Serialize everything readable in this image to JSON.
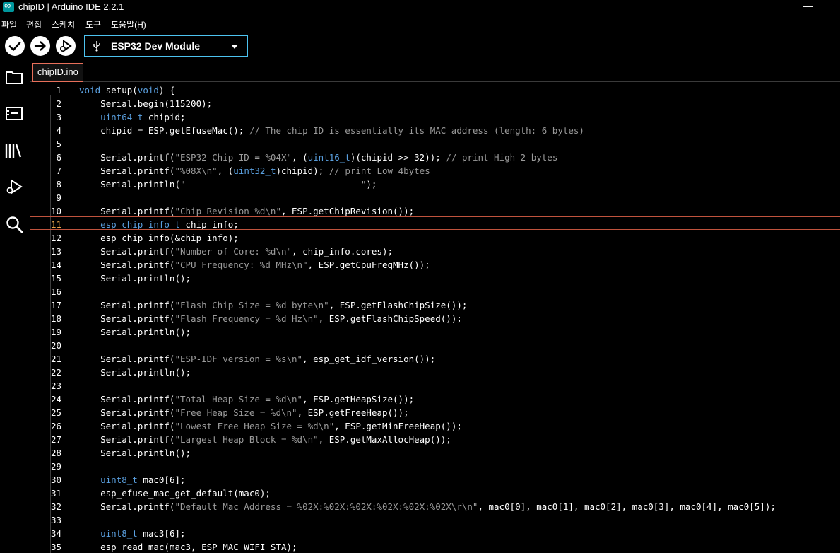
{
  "window": {
    "title": "chipID | Arduino IDE 2.2.1",
    "minimize_glyph": "—"
  },
  "menu": [
    "파일",
    "편집",
    "스케치",
    "도구",
    "도움말(H)"
  ],
  "toolbar": {
    "verify_icon": "checkmark-icon",
    "upload_icon": "arrow-right-icon",
    "debug_icon": "debug-icon",
    "board_icon": "usb-icon",
    "board_name": "ESP32 Dev Module"
  },
  "sidebar": {
    "items": [
      "sketchbook-icon",
      "boards-manager-icon",
      "library-manager-icon",
      "debug-icon",
      "search-icon"
    ]
  },
  "tabs": [
    {
      "label": "chipID.ino"
    }
  ],
  "editor": {
    "active_line": 11,
    "lines": [
      {
        "n": "1",
        "code": "void setup(void) {"
      },
      {
        "n": "2",
        "code": "    Serial.begin(115200);"
      },
      {
        "n": "3",
        "code": "    uint64_t chipid;"
      },
      {
        "n": "4",
        "code": "    chipid = ESP.getEfuseMac(); // The chip ID is essentially its MAC address (length: 6 bytes)"
      },
      {
        "n": "5",
        "code": ""
      },
      {
        "n": "6",
        "code": "    Serial.printf(\"ESP32 Chip ID = %04X\", (uint16_t)(chipid >> 32)); // print High 2 bytes"
      },
      {
        "n": "7",
        "code": "    Serial.printf(\"%08X\\n\", (uint32_t)chipid); // print Low 4bytes"
      },
      {
        "n": "8",
        "code": "    Serial.println(\"---------------------------------\");"
      },
      {
        "n": "9",
        "code": ""
      },
      {
        "n": "10",
        "code": "    Serial.printf(\"Chip Revision %d\\n\", ESP.getChipRevision());"
      },
      {
        "n": "11",
        "code": "    esp_chip_info_t chip_info;"
      },
      {
        "n": "12",
        "code": "    esp_chip_info(&chip_info);"
      },
      {
        "n": "13",
        "code": "    Serial.printf(\"Number of Core: %d\\n\", chip_info.cores);"
      },
      {
        "n": "14",
        "code": "    Serial.printf(\"CPU Frequency: %d MHz\\n\", ESP.getCpuFreqMHz());"
      },
      {
        "n": "15",
        "code": "    Serial.println();"
      },
      {
        "n": "16",
        "code": ""
      },
      {
        "n": "17",
        "code": "    Serial.printf(\"Flash Chip Size = %d byte\\n\", ESP.getFlashChipSize());"
      },
      {
        "n": "18",
        "code": "    Serial.printf(\"Flash Frequency = %d Hz\\n\", ESP.getFlashChipSpeed());"
      },
      {
        "n": "19",
        "code": "    Serial.println();"
      },
      {
        "n": "20",
        "code": ""
      },
      {
        "n": "21",
        "code": "    Serial.printf(\"ESP-IDF version = %s\\n\", esp_get_idf_version());"
      },
      {
        "n": "22",
        "code": "    Serial.println();"
      },
      {
        "n": "23",
        "code": ""
      },
      {
        "n": "24",
        "code": "    Serial.printf(\"Total Heap Size = %d\\n\", ESP.getHeapSize());"
      },
      {
        "n": "25",
        "code": "    Serial.printf(\"Free Heap Size = %d\\n\", ESP.getFreeHeap());"
      },
      {
        "n": "26",
        "code": "    Serial.printf(\"Lowest Free Heap Size = %d\\n\", ESP.getMinFreeHeap());"
      },
      {
        "n": "27",
        "code": "    Serial.printf(\"Largest Heap Block = %d\\n\", ESP.getMaxAllocHeap());"
      },
      {
        "n": "28",
        "code": "    Serial.println();"
      },
      {
        "n": "29",
        "code": ""
      },
      {
        "n": "30",
        "code": "    uint8_t mac0[6];"
      },
      {
        "n": "31",
        "code": "    esp_efuse_mac_get_default(mac0);"
      },
      {
        "n": "32",
        "code": "    Serial.printf(\"Default Mac Address = %02X:%02X:%02X:%02X:%02X:%02X\\r\\n\", mac0[0], mac0[1], mac0[2], mac0[3], mac0[4], mac0[5]);"
      },
      {
        "n": "33",
        "code": ""
      },
      {
        "n": "34",
        "code": "    uint8_t mac3[6];"
      },
      {
        "n": "35",
        "code": "    esp_read_mac(mac3, ESP_MAC_WIFI_STA);"
      }
    ]
  }
}
